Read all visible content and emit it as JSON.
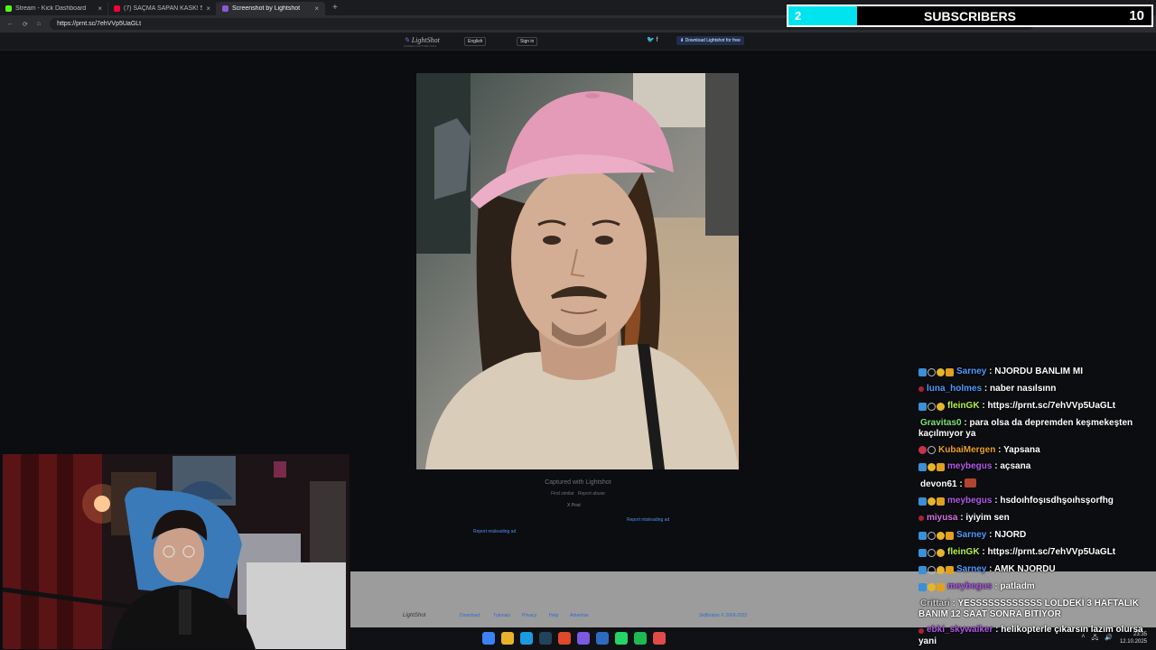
{
  "browser": {
    "tabs": [
      {
        "title": "Stream - Kick Dashboard",
        "favicon_color": "#53fc18",
        "active": false
      },
      {
        "title": "(7) SAÇMA SAPAN KASK! 5Siden...",
        "favicon_color": "#ff0033",
        "active": false
      },
      {
        "title": "Screenshot by Lightshot",
        "favicon_color": "#8a5ad6",
        "active": true
      }
    ],
    "new_tab_label": "+",
    "url": "https://prnt.sc/7ehVVp5UaGLt"
  },
  "lightshot": {
    "logo": "LightShot",
    "tagline": "SCREEN CAPTURE TOOL",
    "language": "English",
    "sign_in": "Sign in",
    "download": "Download Lightshot for free",
    "captured": "Captured with Lightshot",
    "find_similar": "Find similar",
    "report_abuse": "Report abuse",
    "post": "X Post",
    "report_ad_1": "Report misleading ad",
    "report_ad_2": "Report misleading ad",
    "footer": {
      "logo": "LightShot",
      "links": [
        "Download",
        "Tutorials",
        "Privacy",
        "Help",
        "Advertise"
      ],
      "copyright": "Skillbrains © 2009-2022"
    }
  },
  "subscribers": {
    "current": "2",
    "label": "SUBSCRIBERS",
    "goal": "10",
    "progress": 0.19,
    "fill_color": "#00e4f0"
  },
  "chat": [
    {
      "user": "Sarney",
      "color": "#4f9bff",
      "badges": [
        "b-blue",
        "b-ring",
        "b-gold",
        "b-sub"
      ],
      "text": "NJORDU BANLIM MI"
    },
    {
      "user": "luna_holmes",
      "color": "#4f9bff",
      "badges": [
        "b-dot"
      ],
      "text": "naber nasılsınn"
    },
    {
      "user": "fleinGK",
      "color": "#b7f04a",
      "badges": [
        "b-blue",
        "b-ring",
        "b-gold"
      ],
      "text": "https://prnt.sc/7ehVVp5UaGLt"
    },
    {
      "user": "Gravitas0",
      "color": "#7ee37e",
      "badges": [],
      "text": "para olsa da depremden keşmekeşten kaçılmıyor ya"
    },
    {
      "user": "KubaiMergen",
      "color": "#e8a030",
      "badges": [
        "b-red",
        "b-ring"
      ],
      "text": "Yapsana"
    },
    {
      "user": "meybegus",
      "color": "#b05ae8",
      "badges": [
        "b-blue",
        "b-gold",
        "b-sub"
      ],
      "text": "açsana"
    },
    {
      "user": "devon61",
      "color": "#ffffff",
      "badges": [],
      "text": "",
      "emote": true
    },
    {
      "user": "meybegus",
      "color": "#b05ae8",
      "badges": [
        "b-blue",
        "b-gold",
        "b-sub"
      ],
      "text": "hsdoıhfoşısdhşoıhsşorfhg"
    },
    {
      "user": "miyusa",
      "color": "#d873e0",
      "badges": [
        "b-dot"
      ],
      "text": "iyiyim sen"
    },
    {
      "user": "Sarney",
      "color": "#4f9bff",
      "badges": [
        "b-blue",
        "b-ring",
        "b-gold",
        "b-sub"
      ],
      "text": "NJORD"
    },
    {
      "user": "fleinGK",
      "color": "#b7f04a",
      "badges": [
        "b-blue",
        "b-ring",
        "b-gold"
      ],
      "text": "https://prnt.sc/7ehVVp5UaGLt"
    },
    {
      "user": "Sarney",
      "color": "#4f9bff",
      "badges": [
        "b-blue",
        "b-ring",
        "b-gold",
        "b-sub"
      ],
      "text": "AMK NJORDU"
    },
    {
      "user": "meybegus",
      "color": "#b05ae8",
      "badges": [
        "b-blue",
        "b-gold",
        "b-sub"
      ],
      "text": "patladm"
    },
    {
      "user": "Crittari",
      "color": "#cccccc",
      "badges": [],
      "text": "YESSSSSSSSSSSS LOLDEKİ 3 HAFTALIK BANIM 12 SAAT SONRA BİTİYOR"
    },
    {
      "user": "ebki_skywalker",
      "color": "#b05ae8",
      "badges": [
        "b-dot"
      ],
      "text": "helikopterle çıkarsın lazım olursa yani"
    }
  ],
  "taskbar": {
    "app_colors": [
      "#3b82f6",
      "#e8b32a",
      "#1a9be0",
      "#22445a",
      "#e04a2a",
      "#7a5ae0",
      "#2d6bc0",
      "#25d366",
      "#1db954",
      "#e04a4a"
    ],
    "time": "23:35",
    "date": "12.10.2025"
  }
}
